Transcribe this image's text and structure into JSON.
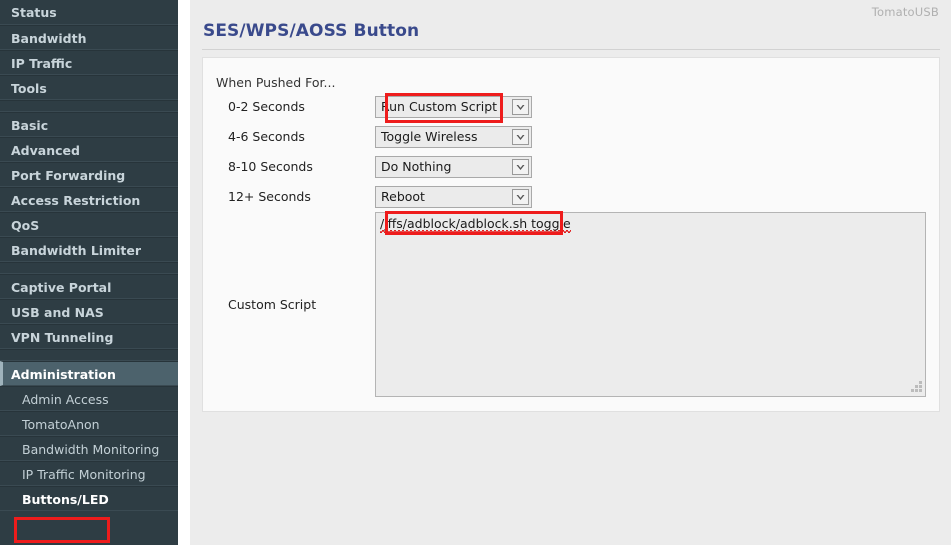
{
  "brand": "TomatoUSB",
  "page": {
    "title": "SES/WPS/AOSS Button"
  },
  "sidebar": {
    "items": [
      {
        "label": "Status",
        "type": "top",
        "name": "status"
      },
      {
        "label": "Bandwidth",
        "type": "top",
        "name": "bandwidth"
      },
      {
        "label": "IP Traffic",
        "type": "top",
        "name": "ip-traffic"
      },
      {
        "label": "Tools",
        "type": "top",
        "name": "tools"
      },
      {
        "label": "",
        "type": "spacer",
        "name": "spacer-1"
      },
      {
        "label": "Basic",
        "type": "top",
        "name": "basic"
      },
      {
        "label": "Advanced",
        "type": "top",
        "name": "advanced"
      },
      {
        "label": "Port Forwarding",
        "type": "top",
        "name": "port-forwarding"
      },
      {
        "label": "Access Restriction",
        "type": "top",
        "name": "access-restriction"
      },
      {
        "label": "QoS",
        "type": "top",
        "name": "qos"
      },
      {
        "label": "Bandwidth Limiter",
        "type": "top",
        "name": "bandwidth-limiter"
      },
      {
        "label": "",
        "type": "spacer",
        "name": "spacer-2"
      },
      {
        "label": "Captive Portal",
        "type": "top",
        "name": "captive-portal"
      },
      {
        "label": "USB and NAS",
        "type": "top",
        "name": "usb-and-nas"
      },
      {
        "label": "VPN Tunneling",
        "type": "top",
        "name": "vpn-tunneling"
      },
      {
        "label": "",
        "type": "spacer",
        "name": "spacer-3"
      },
      {
        "label": "Administration",
        "type": "section-active",
        "name": "administration"
      },
      {
        "label": "Admin Access",
        "type": "sub",
        "name": "admin-access"
      },
      {
        "label": "TomatoAnon",
        "type": "sub",
        "name": "tomatoanon"
      },
      {
        "label": "Bandwidth Monitoring",
        "type": "sub",
        "name": "bandwidth-monitoring"
      },
      {
        "label": "IP Traffic Monitoring",
        "type": "sub",
        "name": "ip-traffic-monitoring"
      },
      {
        "label": "Buttons/LED",
        "type": "sub-active",
        "name": "buttons-led"
      }
    ]
  },
  "form": {
    "section_heading": "When Pushed For...",
    "rows": [
      {
        "label": "0-2 Seconds",
        "value": "Run Custom Script"
      },
      {
        "label": "4-6 Seconds",
        "value": "Toggle Wireless"
      },
      {
        "label": "8-10 Seconds",
        "value": "Do Nothing"
      },
      {
        "label": "12+ Seconds",
        "value": "Reboot"
      }
    ],
    "script": {
      "label": "Custom Script",
      "value": "/jffs/adblock/adblock.sh toggle"
    }
  },
  "annotations": {
    "accent_color": "#ee1c1c",
    "highlighted": [
      "Run Custom Script",
      "/jffs/adblock/adblock.sh toggle",
      "Buttons/LED"
    ]
  },
  "colors": {
    "sidebar_bg": "#2e3d44",
    "sidebar_active_bg": "#4c626c",
    "title": "#3a4a8c",
    "page_bg": "#ececec",
    "panel_bg": "#fafafa"
  }
}
